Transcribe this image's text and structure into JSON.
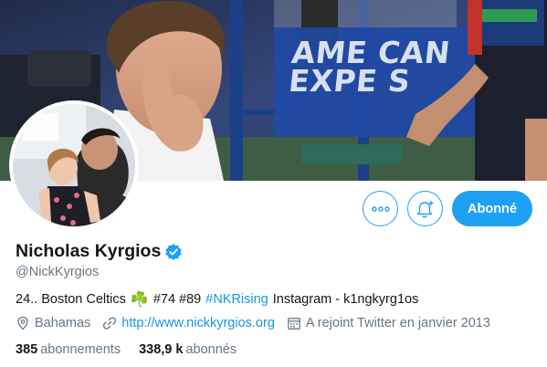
{
  "banner": {
    "sign_lines": [
      "AME  CAN",
      "EXPE S"
    ]
  },
  "actions": {
    "more_icon": "ellipsis-icon",
    "notify_icon": "bell-plus-icon",
    "follow_label": "Abonné"
  },
  "profile": {
    "name": "Nicholas Kyrgios",
    "handle": "@NickKyrgios",
    "bio": {
      "part1": "24.. Boston Celtics",
      "clover": "☘️",
      "part2": "#74 #89",
      "hashtag": "#NKRising",
      "part3": "Instagram - k1ngkyrg1os"
    },
    "location": "Bahamas",
    "website": "http://www.nickkyrgios.org",
    "joined": "A rejoint Twitter en janvier 2013"
  },
  "stats": {
    "following_count": "385",
    "following_label": "abonnements",
    "followers_count": "338,9 k",
    "followers_label": "abonnés"
  },
  "colors": {
    "accent": "#1da1f2",
    "link": "#1b95e0",
    "secondary_text": "#657786"
  }
}
